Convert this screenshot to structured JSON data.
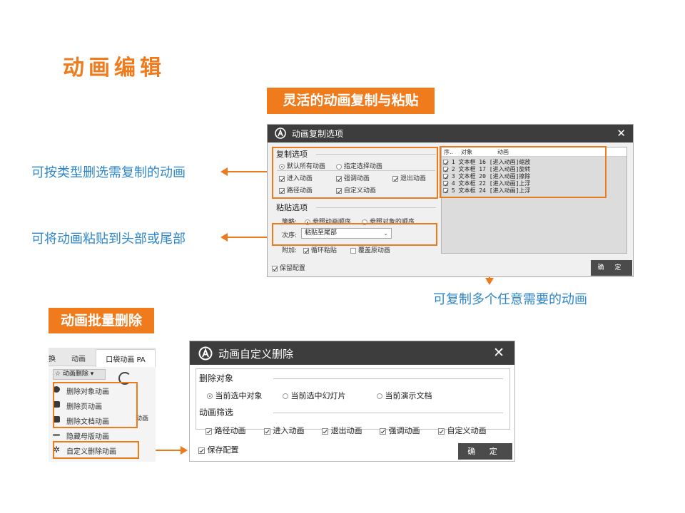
{
  "slide": {
    "title": "动画编辑",
    "banner_copy_paste": "灵活的动画复制与粘贴",
    "banner_batch_delete": "动画批量删除",
    "note_filter_copy": "可按类型删选需复制的动画",
    "note_paste_position": "可将动画粘贴到头部或尾部",
    "note_copy_multiple": "可复制多个任意需要的动画"
  },
  "copy_dialog": {
    "title": "动画复制选项",
    "close": "✕",
    "copy_section_label": "复制选项",
    "radio_default_all": "默认所有动画",
    "radio_specified": "指定选择动画",
    "chk_entrance": "进入动画",
    "chk_emphasis": "强调动画",
    "chk_exit": "退出动画",
    "chk_path": "路径动画",
    "chk_custom": "自定义动画",
    "paste_section_label": "粘贴选项",
    "strategy_label": "策略:",
    "radio_ref_anim_order": "参照动画顺序",
    "radio_ref_obj_order": "参照对象的顺序",
    "order_label": "次序:",
    "order_value": "粘贴至尾部",
    "extra_label": "附加:",
    "chk_loop_paste": "循环粘贴",
    "chk_overwrite": "覆盖原动画",
    "save_config": "保留配置",
    "ok": "确 定",
    "list": {
      "col_seq": "序..",
      "col_object": "对象",
      "col_anim": "动画",
      "rows": [
        {
          "seq": "1",
          "object": "文本框 16",
          "anim": "[进入动画]缩放"
        },
        {
          "seq": "2",
          "object": "文本框 17",
          "anim": "[进入动画]旋转"
        },
        {
          "seq": "3",
          "object": "文本框 20",
          "anim": "[进入动画]擦除"
        },
        {
          "seq": "4",
          "object": "文本框 22",
          "anim": "[进入动画]上浮"
        },
        {
          "seq": "5",
          "object": "文本框 24",
          "anim": "[进入动画]上浮"
        }
      ]
    }
  },
  "ribbon": {
    "tab_switch": "换",
    "tab_animation": "动画",
    "tab_pocket": "口袋动画 PA",
    "dropdown": "☆ 动画删除 ▾",
    "menu": [
      {
        "label": "删除对象动画",
        "icon": "delete-object-icon"
      },
      {
        "label": "删除页动画",
        "icon": "folder-icon"
      },
      {
        "label": "删除文档动画",
        "icon": "folder-icon"
      },
      {
        "label": "隐藏母版动画",
        "icon": "hide-icon"
      },
      {
        "label": "自定义删除动画",
        "icon": "gear-icon"
      }
    ],
    "side_text": "动画"
  },
  "delete_dialog": {
    "title": "动画自定义删除",
    "close": "✕",
    "delete_target_label": "删除对象",
    "radio_current_object": "当前选中对象",
    "radio_current_slide": "当前选中幻灯片",
    "radio_current_doc": "当前演示文档",
    "filter_label": "动画筛选",
    "chk_path": "路径动画",
    "chk_entrance": "进入动画",
    "chk_exit": "退出动画",
    "chk_emphasis": "强调动画",
    "chk_custom": "自定义动画",
    "save_config": "保存配置",
    "ok": "确 定"
  },
  "colors": {
    "accent": "#f07b1c",
    "note_blue": "#2e86c9",
    "titlebar": "#3d3d3d"
  }
}
